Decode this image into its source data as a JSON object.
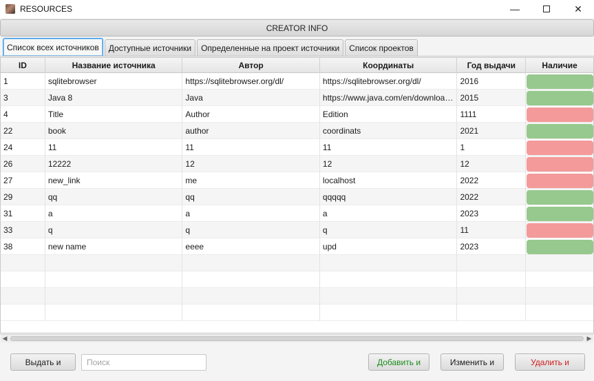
{
  "window": {
    "title": "RESOURCES",
    "minimize": "—",
    "close": "✕"
  },
  "creator_bar": {
    "label": "CREATOR INFO"
  },
  "tabs": [
    {
      "label": "Список всех источников",
      "active": true
    },
    {
      "label": "Доступные источники",
      "active": false
    },
    {
      "label": "Определенные на проект источники",
      "active": false
    },
    {
      "label": "Список проектов",
      "active": false
    }
  ],
  "table": {
    "columns": [
      "ID",
      "Название источника",
      "Автор",
      "Координаты",
      "Год выдачи",
      "Наличие"
    ],
    "rows": [
      {
        "id": "1",
        "name": "sqlitebrowser",
        "author": "https://sqlitebrowser.org/dl/",
        "coords": "https://sqlitebrowser.org/dl/",
        "year": "2016",
        "available": true
      },
      {
        "id": "3",
        "name": "Java 8",
        "author": "Java",
        "coords": "https://www.java.com/en/downloa…",
        "year": "2015",
        "available": true
      },
      {
        "id": "4",
        "name": "Title",
        "author": "Author",
        "coords": "Edition",
        "year": "1111",
        "available": false
      },
      {
        "id": "22",
        "name": "book",
        "author": "author",
        "coords": "coordinats",
        "year": "2021",
        "available": true
      },
      {
        "id": "24",
        "name": "11",
        "author": "11",
        "coords": "11",
        "year": "1",
        "available": false
      },
      {
        "id": "26",
        "name": "12222",
        "author": "12",
        "coords": "12",
        "year": "12",
        "available": false
      },
      {
        "id": "27",
        "name": "new_link",
        "author": "me",
        "coords": "localhost",
        "year": "2022",
        "available": false
      },
      {
        "id": "29",
        "name": "qq",
        "author": "qq",
        "coords": "qqqqq",
        "year": "2022",
        "available": true
      },
      {
        "id": "31",
        "name": "a",
        "author": "a",
        "coords": "a",
        "year": "2023",
        "available": true
      },
      {
        "id": "33",
        "name": "q",
        "author": "q",
        "coords": "q",
        "year": "11",
        "available": false
      },
      {
        "id": "38",
        "name": "new name",
        "author": "eeee",
        "coords": "upd",
        "year": "2023",
        "available": true
      }
    ]
  },
  "colors": {
    "available": "#97c98e",
    "unavailable": "#f49a9a",
    "add_text": "#1a8a1a",
    "delete_text": "#d01a1a"
  },
  "footer": {
    "issue_button": "Выдать и",
    "search_placeholder": "Поиск",
    "add_button": "Добавить и",
    "edit_button": "Изменить и",
    "delete_button": "Удалить и"
  }
}
